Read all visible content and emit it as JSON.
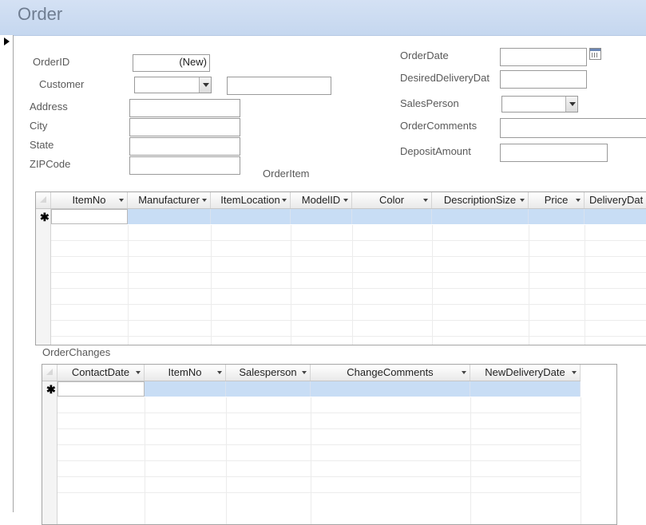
{
  "form": {
    "title": "Order"
  },
  "fields": {
    "order_id_label": "OrderID",
    "order_id_value": "(New)",
    "customer_label": "Customer",
    "address_label": "Address",
    "city_label": "City",
    "state_label": "State",
    "zip_label": "ZIPCode",
    "order_date_label": "OrderDate",
    "desired_delivery_label": "DesiredDeliveryDat",
    "salesperson_label": "SalesPerson",
    "order_comments_label": "OrderComments",
    "deposit_amount_label": "DepositAmount"
  },
  "order_item": {
    "title": "OrderItem",
    "new_row_marker": "✱",
    "columns": [
      "ItemNo",
      "Manufacturer",
      "ItemLocation",
      "ModelID",
      "Color",
      "DescriptionSize",
      "Price",
      "DeliveryDat"
    ]
  },
  "order_changes": {
    "title": "OrderChanges",
    "new_row_marker": "✱",
    "columns": [
      "ContactDate",
      "ItemNo",
      "Salesperson",
      "ChangeComments",
      "NewDeliveryDate"
    ]
  },
  "colors": {
    "header_bg": "#c5d7ef",
    "selection": "#c8ddf5"
  }
}
